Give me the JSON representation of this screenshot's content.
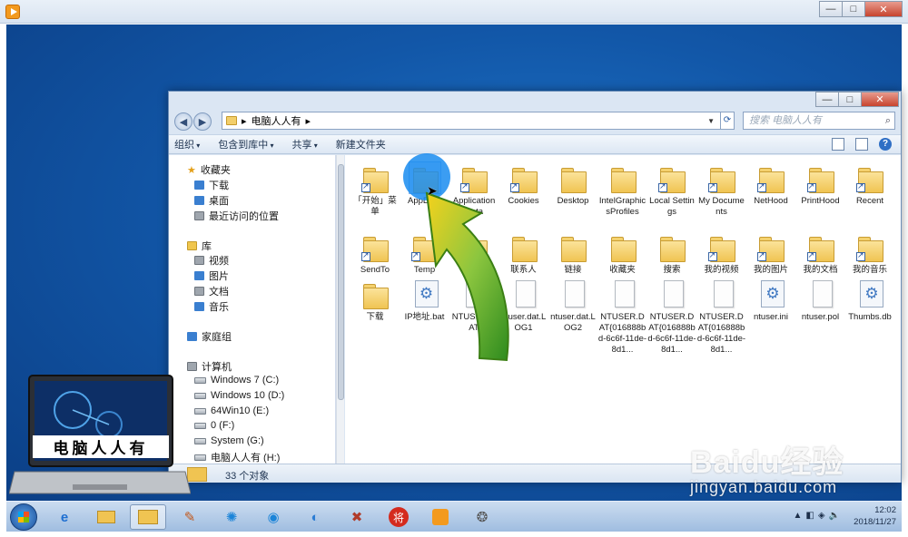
{
  "outer_window": {
    "controls": [
      "—",
      "□",
      "✕"
    ]
  },
  "explorer": {
    "address": {
      "path_label": "电脑人人有",
      "separator": "▸",
      "search_placeholder": "搜索 电脑人人有"
    },
    "toolbar": {
      "organize": "组织",
      "include_in_library": "包含到库中",
      "share": "共享",
      "new_folder": "新建文件夹"
    },
    "nav_pane": {
      "favorites": {
        "title": "收藏夹",
        "items": [
          "下载",
          "桌面",
          "最近访问的位置"
        ]
      },
      "libraries": {
        "title": "库",
        "items": [
          "视频",
          "图片",
          "文档",
          "音乐"
        ]
      },
      "homegroup": "家庭组",
      "computer": {
        "title": "计算机",
        "drives": [
          "Windows 7 (C:)",
          "Windows 10 (D:)",
          "64Win10 (E:)",
          "0 (F:)",
          "System (G:)",
          "电脑人人有 (H:)"
        ]
      }
    },
    "files": [
      {
        "label": "「开始」菜单",
        "type": "folder",
        "shortcut": true
      },
      {
        "label": "AppData",
        "type": "folder",
        "shortcut": false,
        "selected": true
      },
      {
        "label": "Application Data",
        "type": "folder",
        "shortcut": true
      },
      {
        "label": "Cookies",
        "type": "folder",
        "shortcut": true
      },
      {
        "label": "Desktop",
        "type": "folder",
        "shortcut": false
      },
      {
        "label": "IntelGraphicsProfiles",
        "type": "folder",
        "shortcut": false
      },
      {
        "label": "Local Settings",
        "type": "folder",
        "shortcut": true
      },
      {
        "label": "My Documents",
        "type": "folder",
        "shortcut": true
      },
      {
        "label": "NetHood",
        "type": "folder",
        "shortcut": true
      },
      {
        "label": "PrintHood",
        "type": "folder",
        "shortcut": true
      },
      {
        "label": "Recent",
        "type": "folder",
        "shortcut": true
      },
      {
        "label": "SendTo",
        "type": "folder",
        "shortcut": true
      },
      {
        "label": "Temp",
        "type": "folder",
        "shortcut": true
      },
      {
        "label": "",
        "type": "folder",
        "shortcut": false
      },
      {
        "label": "联系人",
        "type": "folder",
        "shortcut": false
      },
      {
        "label": "链接",
        "type": "folder",
        "shortcut": false
      },
      {
        "label": "收藏夹",
        "type": "folder",
        "shortcut": false
      },
      {
        "label": "搜索",
        "type": "folder",
        "shortcut": false
      },
      {
        "label": "我的视频",
        "type": "folder",
        "shortcut": true
      },
      {
        "label": "我的图片",
        "type": "folder",
        "shortcut": true
      },
      {
        "label": "我的文档",
        "type": "folder",
        "shortcut": true
      },
      {
        "label": "我的音乐",
        "type": "folder",
        "shortcut": true
      },
      {
        "label": "下载",
        "type": "folder",
        "shortcut": false
      },
      {
        "label": "IP地址.bat",
        "type": "gear",
        "shortcut": false
      },
      {
        "label": "NTUSER.DAT",
        "type": "doc",
        "shortcut": false
      },
      {
        "label": "ntuser.dat.LOG1",
        "type": "doc",
        "shortcut": false
      },
      {
        "label": "ntuser.dat.LOG2",
        "type": "doc",
        "shortcut": false
      },
      {
        "label": "NTUSER.DAT{016888bd-6c6f-11de-8d1...",
        "type": "doc",
        "shortcut": false
      },
      {
        "label": "NTUSER.DAT{016888bd-6c6f-11de-8d1...",
        "type": "doc",
        "shortcut": false
      },
      {
        "label": "NTUSER.DAT{016888bd-6c6f-11de-8d1...",
        "type": "doc",
        "shortcut": false
      },
      {
        "label": "ntuser.ini",
        "type": "gear",
        "shortcut": false
      },
      {
        "label": "ntuser.pol",
        "type": "doc",
        "shortcut": false
      },
      {
        "label": "Thumbs.db",
        "type": "gear",
        "shortcut": false
      }
    ],
    "status": "33 个对象"
  },
  "laptop_logo_text": "电脑人人有",
  "taskbar": {
    "apps": [
      "ie-icon",
      "folder-icon",
      "explorer-icon",
      "paint-icon",
      "pinwheel-icon",
      "player-icon",
      "edge-icon",
      "tools-icon",
      "chess-icon",
      "video-icon",
      "cat-icon"
    ],
    "time": "12:02",
    "date": "2018/11/27"
  },
  "watermark": {
    "logo": "Baidu经验",
    "url": "jingyan.baidu.com"
  },
  "colors": {
    "desktop": "#1257a8",
    "accent": "#2f6fc5",
    "folder": "#f0c452",
    "arrow_green": "#5aa61e",
    "arrow_yellow": "#f0c419"
  }
}
